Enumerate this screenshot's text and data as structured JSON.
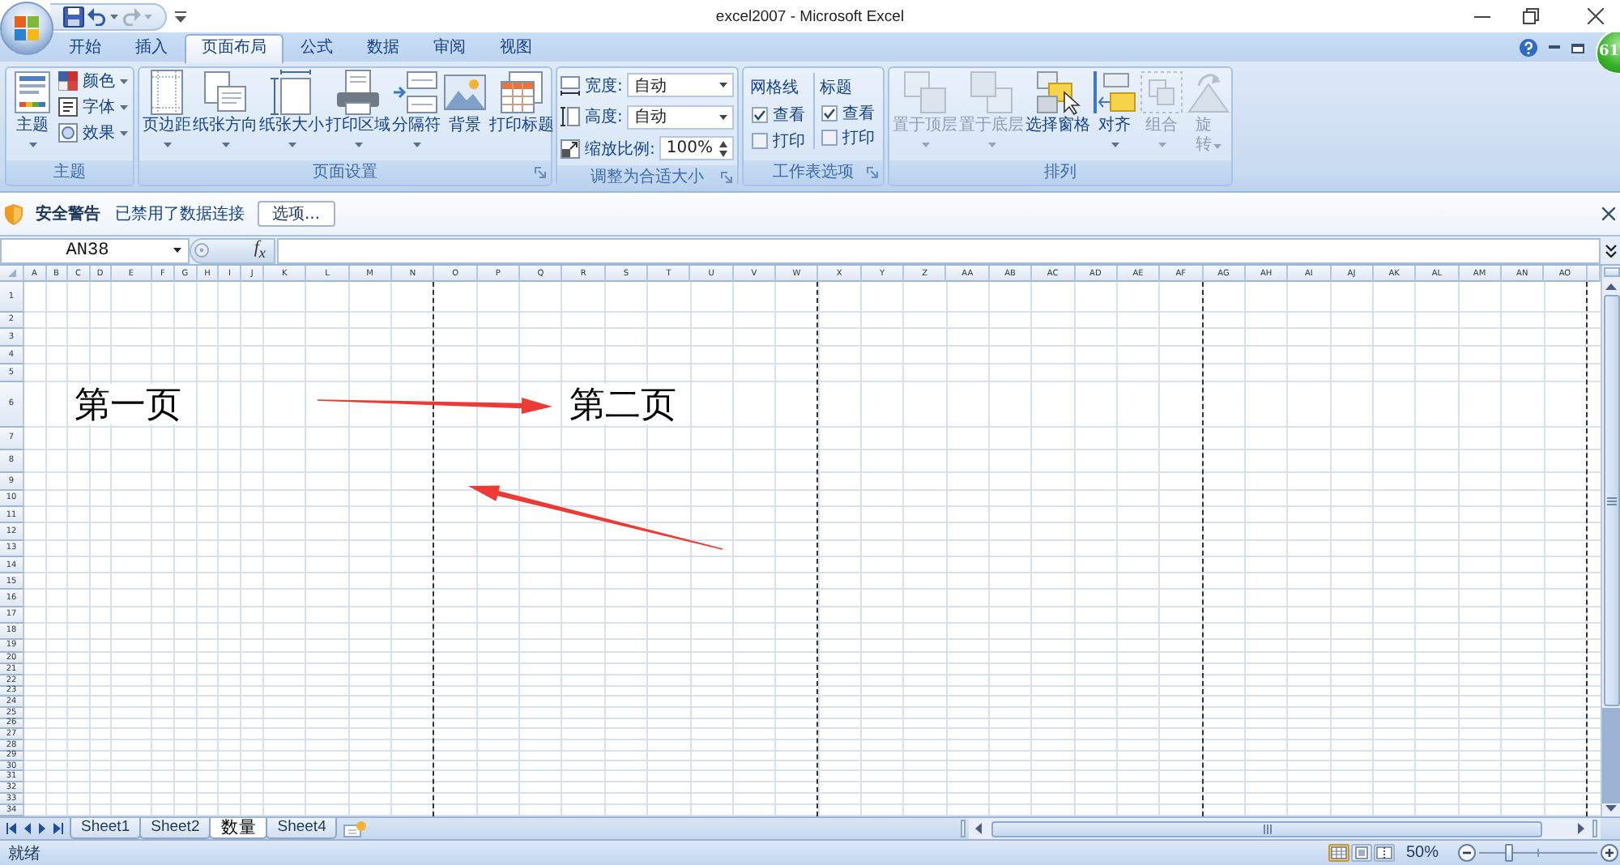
{
  "window": {
    "title": "excel2007 - Microsoft Excel"
  },
  "tabs": [
    {
      "label": "开始",
      "selected": false
    },
    {
      "label": "插入",
      "selected": false
    },
    {
      "label": "页面布局",
      "selected": true
    },
    {
      "label": "公式",
      "selected": false
    },
    {
      "label": "数据",
      "selected": false
    },
    {
      "label": "审阅",
      "selected": false
    },
    {
      "label": "视图",
      "selected": false
    }
  ],
  "floating_badge": {
    "label": "61"
  },
  "ribbon": {
    "groups": [
      {
        "label": "主题",
        "launcher": false,
        "items": [
          {
            "kind": "large",
            "label": "主题",
            "dropdown": true,
            "disabled": false
          },
          {
            "kind": "small",
            "label": "颜色",
            "dropdown": true,
            "disabled": false
          },
          {
            "kind": "small",
            "label": "字体",
            "dropdown": true,
            "disabled": false
          },
          {
            "kind": "small",
            "label": "效果",
            "dropdown": true,
            "disabled": false
          }
        ]
      },
      {
        "label": "页面设置",
        "launcher": true,
        "items": [
          {
            "kind": "large",
            "label": "页边距",
            "dropdown": true,
            "disabled": false
          },
          {
            "kind": "large",
            "label": "纸张方向",
            "dropdown": true,
            "disabled": false
          },
          {
            "kind": "large",
            "label": "纸张大小",
            "dropdown": true,
            "disabled": false
          },
          {
            "kind": "large",
            "label": "打印区域",
            "dropdown": true,
            "disabled": false
          },
          {
            "kind": "large",
            "label": "分隔符",
            "dropdown": true,
            "disabled": false
          },
          {
            "kind": "large",
            "label": "背景",
            "dropdown": false,
            "disabled": false
          },
          {
            "kind": "large",
            "label": "打印标题",
            "dropdown": false,
            "disabled": false
          }
        ]
      },
      {
        "label": "调整为合适大小",
        "launcher": true,
        "items": [
          {
            "kind": "combo",
            "label": "宽度:",
            "value": "自动",
            "disabled": false
          },
          {
            "kind": "combo",
            "label": "高度:",
            "value": "自动",
            "disabled": false
          },
          {
            "kind": "spinner",
            "label": "缩放比例:",
            "value": "100%",
            "disabled": false
          }
        ]
      },
      {
        "label": "工作表选项",
        "launcher": true,
        "items": [
          {
            "kind": "options",
            "heading": "网格线",
            "disabled": false,
            "options": [
              {
                "label": "查看",
                "checked": true
              },
              {
                "label": "打印",
                "checked": false
              }
            ]
          },
          {
            "kind": "options",
            "heading": "标题",
            "disabled": false,
            "options": [
              {
                "label": "查看",
                "checked": true
              },
              {
                "label": "打印",
                "checked": false
              }
            ]
          }
        ]
      },
      {
        "label": "排列",
        "launcher": false,
        "items": [
          {
            "kind": "large",
            "label": "置于顶层",
            "dropdown": true,
            "disabled": true
          },
          {
            "kind": "large",
            "label": "置于底层",
            "dropdown": true,
            "disabled": true
          },
          {
            "kind": "large",
            "label": "选择窗格",
            "dropdown": false,
            "disabled": false
          },
          {
            "kind": "large",
            "label": "对齐",
            "dropdown": true,
            "disabled": false
          },
          {
            "kind": "large",
            "label": "组合",
            "dropdown": true,
            "disabled": true
          },
          {
            "kind": "narrow",
            "label": "旋转",
            "dropdown": true,
            "disabled": true
          }
        ]
      }
    ]
  },
  "security_bar": {
    "title": "安全警告",
    "message": "已禁用了数据连接",
    "button": "选项..."
  },
  "formula_bar": {
    "name_box": "AN38",
    "function_button": "f$_{x}$"
  },
  "sheet": {
    "columns": [
      {
        "label": "A",
        "page_break": false
      },
      {
        "label": "B",
        "page_break": false
      },
      {
        "label": "C",
        "page_break": false
      },
      {
        "label": "D",
        "page_break": false
      },
      {
        "label": "E",
        "page_break": false
      },
      {
        "label": "F",
        "page_break": false
      },
      {
        "label": "G",
        "page_break": false
      },
      {
        "label": "H",
        "page_break": false
      },
      {
        "label": "I",
        "page_break": false
      },
      {
        "label": "J",
        "page_break": false
      },
      {
        "label": "K",
        "page_break": false
      },
      {
        "label": "L",
        "page_break": false
      },
      {
        "label": "M",
        "page_break": false
      },
      {
        "label": "N",
        "page_break": true
      },
      {
        "label": "O",
        "page_break": false
      },
      {
        "label": "P",
        "page_break": false
      },
      {
        "label": "Q",
        "page_break": false
      },
      {
        "label": "R",
        "page_break": false
      },
      {
        "label": "S",
        "page_break": false
      },
      {
        "label": "T",
        "page_break": false
      },
      {
        "label": "U",
        "page_break": false
      },
      {
        "label": "V",
        "page_break": false
      },
      {
        "label": "W",
        "page_break": true
      },
      {
        "label": "X",
        "page_break": false
      },
      {
        "label": "Y",
        "page_break": false
      },
      {
        "label": "Z",
        "page_break": false
      },
      {
        "label": "AA",
        "page_break": false
      },
      {
        "label": "AB",
        "page_break": false
      },
      {
        "label": "AC",
        "page_break": false
      },
      {
        "label": "AD",
        "page_break": false
      },
      {
        "label": "AE",
        "page_break": false
      },
      {
        "label": "AF",
        "page_break": true
      },
      {
        "label": "AG",
        "page_break": false
      },
      {
        "label": "AH",
        "page_break": false
      },
      {
        "label": "AI",
        "page_break": false
      },
      {
        "label": "AJ",
        "page_break": false
      },
      {
        "label": "AK",
        "page_break": false
      },
      {
        "label": "AL",
        "page_break": false
      },
      {
        "label": "AM",
        "page_break": false
      },
      {
        "label": "AN",
        "page_break": false
      },
      {
        "label": "AO",
        "page_break": true
      }
    ],
    "rows": [
      {
        "label": "1"
      },
      {
        "label": "2"
      },
      {
        "label": "3"
      },
      {
        "label": "4"
      },
      {
        "label": "5"
      },
      {
        "label": "6",
        "cells": [
          {
            "text": "第一页"
          },
          {
            "text": "第二页"
          }
        ]
      },
      {
        "label": "7"
      },
      {
        "label": "8"
      },
      {
        "label": "9"
      },
      {
        "label": "10"
      },
      {
        "label": "11"
      },
      {
        "label": "12"
      },
      {
        "label": "13"
      },
      {
        "label": "14"
      },
      {
        "label": "15"
      },
      {
        "label": "16"
      },
      {
        "label": "17"
      },
      {
        "label": "18"
      },
      {
        "label": "19"
      },
      {
        "label": "20"
      },
      {
        "label": "21"
      },
      {
        "label": "22"
      },
      {
        "label": "23"
      },
      {
        "label": "24"
      },
      {
        "label": "25"
      },
      {
        "label": "26"
      },
      {
        "label": "27"
      },
      {
        "label": "28"
      },
      {
        "label": "29"
      },
      {
        "label": "30"
      },
      {
        "label": "31"
      },
      {
        "label": "32"
      },
      {
        "label": "33"
      },
      {
        "label": "34"
      }
    ]
  },
  "sheet_tabs": [
    {
      "label": "Sheet1",
      "selected": false
    },
    {
      "label": "Sheet2",
      "selected": false
    },
    {
      "label": "数量",
      "selected": true
    },
    {
      "label": "Sheet4",
      "selected": false
    }
  ],
  "status_bar": {
    "status": "就绪",
    "views": [
      {
        "selected": true
      },
      {
        "selected": false
      },
      {
        "selected": false
      }
    ],
    "zoom": {
      "reading": "50%",
      "level": 0.25
    }
  }
}
